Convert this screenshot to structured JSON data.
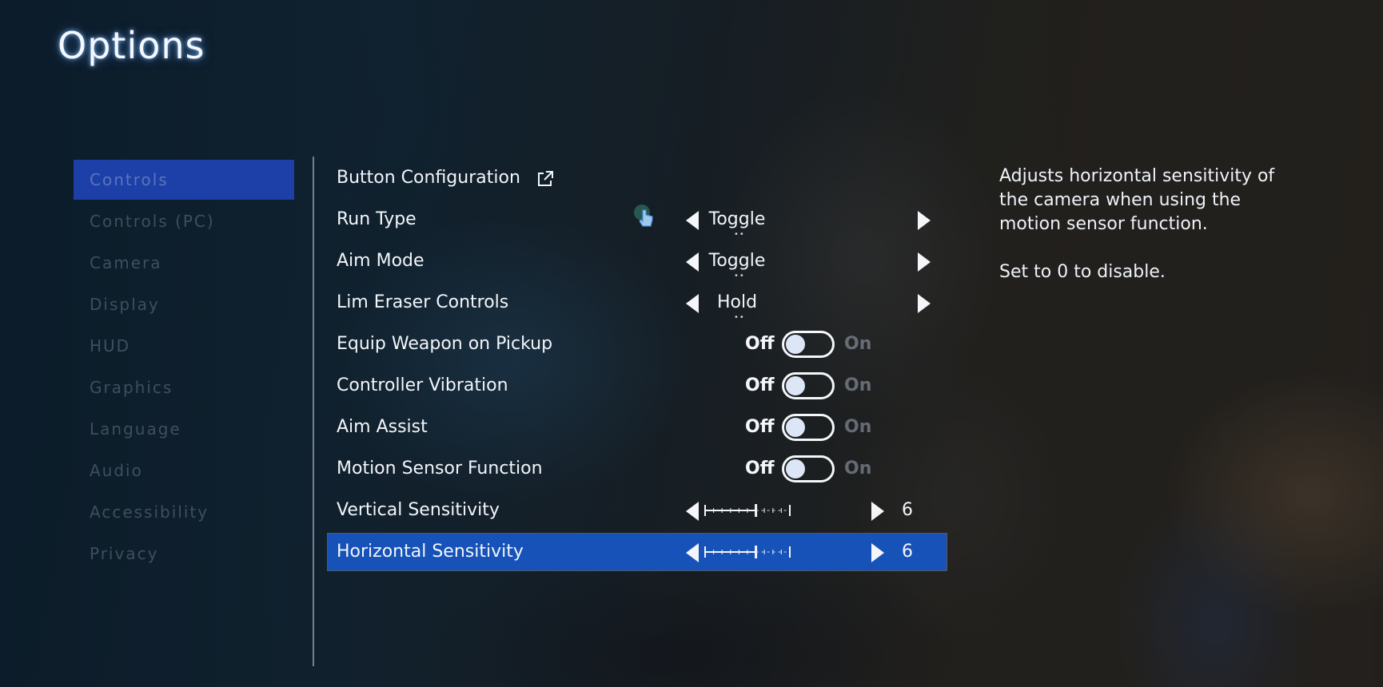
{
  "page": {
    "title": "Options"
  },
  "menu": {
    "items": [
      {
        "label": "Controls",
        "active": true
      },
      {
        "label": "Controls (PC)",
        "active": false
      },
      {
        "label": "Camera",
        "active": false
      },
      {
        "label": "Display",
        "active": false
      },
      {
        "label": "HUD",
        "active": false
      },
      {
        "label": "Graphics",
        "active": false
      },
      {
        "label": "Language",
        "active": false
      },
      {
        "label": "Audio",
        "active": false
      },
      {
        "label": "Accessibility",
        "active": false
      },
      {
        "label": "Privacy",
        "active": false
      }
    ]
  },
  "options": {
    "button_config": {
      "label": "Button Configuration",
      "icon": "external-link-icon"
    },
    "run_type": {
      "label": "Run Type",
      "value": "Toggle"
    },
    "aim_mode": {
      "label": "Aim Mode",
      "value": "Toggle"
    },
    "lim_eraser": {
      "label": "Lim Eraser Controls",
      "value": "Hold"
    },
    "toggle_off_label": "Off",
    "toggle_on_label": "On",
    "equip_weapon": {
      "label": "Equip Weapon on Pickup",
      "state": "Off"
    },
    "controller_vibration": {
      "label": "Controller Vibration",
      "state": "Off"
    },
    "aim_assist": {
      "label": "Aim Assist",
      "state": "Off"
    },
    "motion_sensor": {
      "label": "Motion Sensor Function",
      "state": "Off"
    },
    "vertical_sensitivity": {
      "label": "Vertical Sensitivity",
      "value": "6",
      "level": 6,
      "max": 10
    },
    "horizontal_sensitivity": {
      "label": "Horizontal Sensitivity",
      "value": "6",
      "level": 6,
      "max": 10,
      "selected": true
    }
  },
  "description": {
    "line1": "Adjusts horizontal sensitivity of the camera when using the motion sensor function.",
    "line2": "Set to 0 to disable."
  },
  "colors": {
    "accent": "#1652b8",
    "menu_active": "#1d3fa8",
    "glow": "#7fb4ff"
  }
}
